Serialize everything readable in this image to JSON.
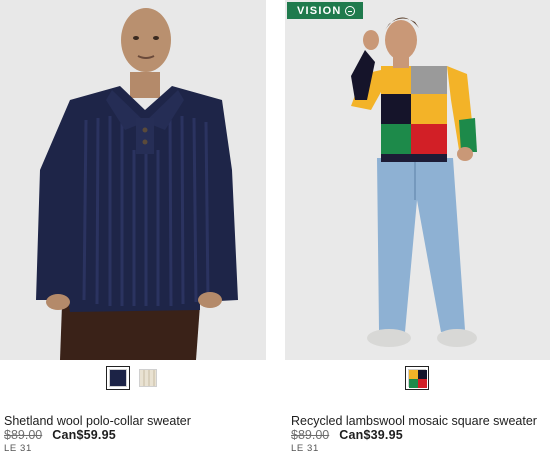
{
  "products": [
    {
      "name": "Shetland wool polo-collar sweater",
      "old_price": "$89.00",
      "new_price": "Can$59.95",
      "code": "LE 31",
      "swatches": [
        {
          "color": "#1c2346",
          "selected": true
        },
        {
          "color": "#e6dfcf",
          "selected": false
        }
      ]
    },
    {
      "badge": "VISION",
      "name": "Recycled lambswool mosaic square sweater",
      "old_price": "$89.00",
      "new_price": "Can$39.95",
      "code": "LE 31",
      "swatches": [
        {
          "color": "mosaic",
          "selected": true
        }
      ]
    }
  ],
  "colors": {
    "badge_green": "#1f7a4d",
    "navy_sweater": "#1c2346",
    "photo_background": "#e9e9e9"
  }
}
